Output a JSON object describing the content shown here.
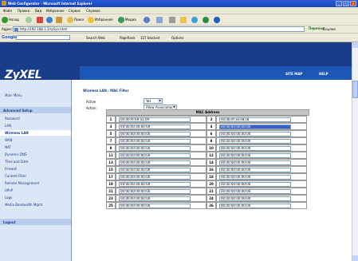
{
  "window": {
    "title": "Web Configurator - Microsoft Internet Explorer",
    "buttons": [
      "_",
      "□",
      "×"
    ]
  },
  "menubar": [
    "Файл",
    "Правка",
    "Вид",
    "Избранное",
    "Сервис",
    "Справка"
  ],
  "toolbar": {
    "back_label": "Назад",
    "search_label": "Поиск",
    "favorites_label": "Избранное",
    "media_label": "Медиа"
  },
  "address": {
    "label": "Адрес:",
    "url": "http://192.168.1.1/rpSys.html",
    "go_label": "Переход",
    "links_label": "Ссылки"
  },
  "googlebar": {
    "logo": "Google",
    "items": [
      "Search Web",
      "PageRank",
      "327 blocked",
      "Options"
    ]
  },
  "header": {
    "logo": "ZyXEL",
    "logo_sub": "Your Internet Access Device",
    "site_map": "SITE MAP",
    "help": "HELP"
  },
  "sidebar": {
    "main_menu": "Main Menu",
    "advanced_setup": "Advanced Setup",
    "items": [
      "Password",
      "LAN",
      "Wireless LAN",
      "WAN",
      "NAT",
      "Dynamic DNS",
      "Time and Date",
      "Firewall",
      "Content Filter",
      "Remote Management",
      "UPnP",
      "Logs",
      "Media Bandwidth Mgmt"
    ],
    "selected_item": "Wireless LAN",
    "logout": "Logout"
  },
  "content": {
    "subtitle": "Wireless LAN - MAC Filter",
    "active_label": "Active",
    "active_value": "Yes",
    "action_label": "Action",
    "action_value": "Allow Association",
    "table_header": "MAC Address",
    "rows": [
      {
        "n1": "1",
        "m1": "00:40:f4:b9:a1:09",
        "n2": "2",
        "m2": "00:0b:0f:3e:e8:c8"
      },
      {
        "n1": "3",
        "m1": "00:00:00:00:00:00",
        "n2": "4",
        "m2": "00:00:00:00:00:00"
      },
      {
        "n1": "5",
        "m1": "00:00:00:00:00:00",
        "n2": "6",
        "m2": "00:00:00:00:00:00"
      },
      {
        "n1": "7",
        "m1": "00:00:00:00:00:00",
        "n2": "8",
        "m2": "00:00:00:00:00:00"
      },
      {
        "n1": "9",
        "m1": "00:00:00:00:00:00",
        "n2": "10",
        "m2": "00:00:00:00:00:00"
      },
      {
        "n1": "11",
        "m1": "00:00:00:00:00:00",
        "n2": "12",
        "m2": "00:00:00:00:00:00"
      },
      {
        "n1": "13",
        "m1": "00:00:00:00:00:00",
        "n2": "14",
        "m2": "00:00:00:00:00:00"
      },
      {
        "n1": "15",
        "m1": "00:00:00:00:00:00",
        "n2": "16",
        "m2": "00:00:00:00:00:00"
      },
      {
        "n1": "17",
        "m1": "00:00:00:00:00:00",
        "n2": "18",
        "m2": "00:00:00:00:00:00"
      },
      {
        "n1": "19",
        "m1": "00:00:00:00:00:00",
        "n2": "20",
        "m2": "00:00:00:00:00:00"
      },
      {
        "n1": "21",
        "m1": "00:00:00:00:00:00",
        "n2": "22",
        "m2": "00:00:00:00:00:00"
      },
      {
        "n1": "23",
        "m1": "00:00:00:00:00:00",
        "n2": "24",
        "m2": "00:00:00:00:00:00"
      },
      {
        "n1": "25",
        "m1": "00:00:00:00:00:00",
        "n2": "26",
        "m2": "00:00:00:00:00:00"
      }
    ],
    "selected_cell": "m2-row-1"
  },
  "colors": {
    "header_bg": "#1a3d8a",
    "nav_bg": "#1e56b5",
    "sidebar_bg": "#dbe6f7",
    "selected_input": "#3a5fcd"
  }
}
